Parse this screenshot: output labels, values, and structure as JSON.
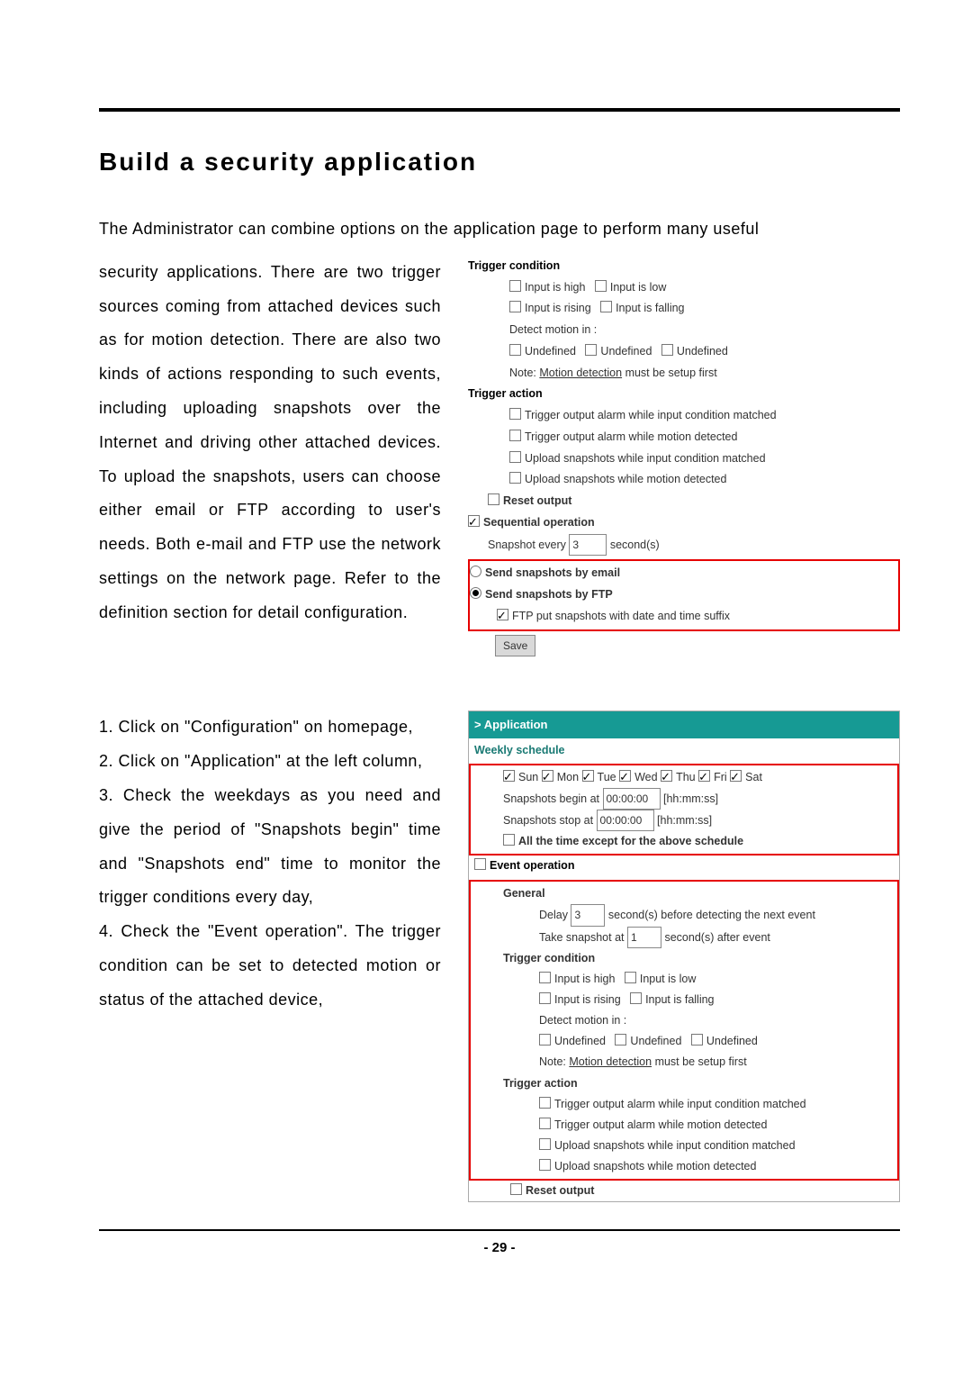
{
  "heading": "Build a security application",
  "intro": "The Administrator can combine options on the application page to perform many useful",
  "left_paragraph": "security applications. There are two trigger sources coming from attached devices such as for motion detection. There are also two kinds of actions responding to such events, including uploading snapshots over the Internet and driving other attached devices. To upload the snapshots, users can choose either email or FTP according to user's needs. Both e-mail and FTP use the network settings on the network page. Refer to the definition section for detail configuration.",
  "steps": {
    "s1": "1. Click on \"Configuration\" on homepage,",
    "s2": "2. Click on \"Application\" at the left column,",
    "s3": "3. Check the weekdays as you need and give the period of \"Snapshots begin\" time and \"Snapshots end\" time to monitor the trigger conditions every day,",
    "s4": "4. Check the \"Event operation\". The trigger condition can be set to detected motion or status of the attached device,"
  },
  "panel1": {
    "trigger_condition_hdr": "Trigger condition",
    "input_high": "Input is high",
    "input_low": "Input is low",
    "input_rising": "Input is rising",
    "input_falling": "Input is falling",
    "detect_motion": "Detect motion in :",
    "undef": "Undefined",
    "note_prefix": "Note: ",
    "note_link": "Motion detection",
    "note_suffix": " must be setup first",
    "trigger_action_hdr": "Trigger action",
    "ta1": "Trigger output alarm while input condition matched",
    "ta2": "Trigger output alarm while motion detected",
    "ta3": "Upload snapshots while input condition matched",
    "ta4": "Upload snapshots while motion detected",
    "reset_output": "Reset output",
    "sequential_hdr": "Sequential operation",
    "snapshot_every_prefix": "Snapshot every ",
    "snapshot_every_value": "3",
    "snapshot_every_suffix": " second(s)",
    "send_email": "Send snapshots by email",
    "send_ftp": "Send snapshots by FTP",
    "ftp_suffix": "FTP put snapshots with date and time suffix",
    "save": "Save"
  },
  "panel2": {
    "app_hdr": "> Application",
    "weekly_hdr": "Weekly schedule",
    "days": {
      "sun": "Sun",
      "mon": "Mon",
      "tue": "Tue",
      "wed": "Wed",
      "thu": "Thu",
      "fri": "Fri",
      "sat": "Sat"
    },
    "snap_begin_prefix": "Snapshots begin at ",
    "snap_time1": "00:00:00",
    "snap_hhmmss": " [hh:mm:ss]",
    "snap_stop_prefix": "Snapshots stop at ",
    "snap_time2": "00:00:00",
    "all_time_except": "All the time except for the above schedule",
    "event_op_hdr": "Event operation",
    "general": "General",
    "delay_prefix": "Delay ",
    "delay_value": "3",
    "delay_suffix": " second(s) before detecting the next event",
    "take_prefix": "Take snapshot at ",
    "take_value": "1",
    "take_suffix": " second(s) after event",
    "trigger_condition_hdr": "Trigger condition",
    "input_high": "Input is high",
    "input_low": "Input is low",
    "input_rising": "Input is rising",
    "input_falling": "Input is falling",
    "detect_motion": "Detect motion in :",
    "undef": "Undefined",
    "note_prefix": "Note: ",
    "note_link": "Motion detection",
    "note_suffix": " must be setup first",
    "trigger_action_hdr": "Trigger action",
    "ta1": "Trigger output alarm while input condition matched",
    "ta2": "Trigger output alarm while motion detected",
    "ta3": "Upload snapshots while input condition matched",
    "ta4": "Upload snapshots while motion detected",
    "reset_output": "Reset output"
  },
  "page_number": "- 29 -"
}
